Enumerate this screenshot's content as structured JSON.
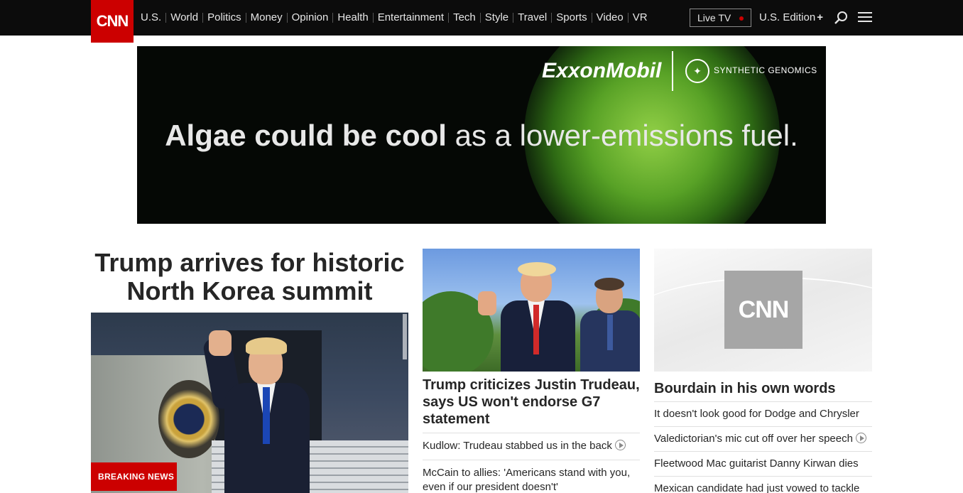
{
  "header": {
    "logo_text": "CNN",
    "nav_items": [
      "U.S.",
      "World",
      "Politics",
      "Money",
      "Opinion",
      "Health",
      "Entertainment",
      "Tech",
      "Style",
      "Travel",
      "Sports",
      "Video",
      "VR"
    ],
    "live_tv_label": "Live TV",
    "edition_label": "U.S. Edition",
    "edition_plus": "+"
  },
  "ad": {
    "brand_primary": "ExxonMobil",
    "brand_secondary": "SYNTHETIC GENOMICS",
    "tagline_bold": "Algae could be cool",
    "tagline_rest": " as a lower-emissions fuel."
  },
  "lead": {
    "headline": "Trump arrives for historic North Korea summit",
    "badge": "BREAKING NEWS"
  },
  "middle": {
    "headline": "Trump criticizes Justin Trudeau, says US won't endorse G7 statement",
    "items": [
      {
        "text": "Kudlow: Trudeau stabbed us in the back",
        "video": true
      },
      {
        "text": "McCain to allies: 'Americans stand with you, even if our president doesn't'",
        "video": false
      }
    ]
  },
  "right": {
    "image_logo": "CNN",
    "headline": "Bourdain in his own words",
    "items": [
      {
        "text": "It doesn't look good for Dodge and Chrysler",
        "video": false
      },
      {
        "text": "Valedictorian's mic cut off over her speech",
        "video": true
      },
      {
        "text": "Fleetwood Mac guitarist Danny Kirwan dies",
        "video": false
      },
      {
        "text": "Mexican candidate had just vowed to tackle",
        "video": false
      }
    ]
  },
  "colors": {
    "brand_red": "#cc0000",
    "nav_bg": "#0c0c0c",
    "text": "#262626"
  }
}
